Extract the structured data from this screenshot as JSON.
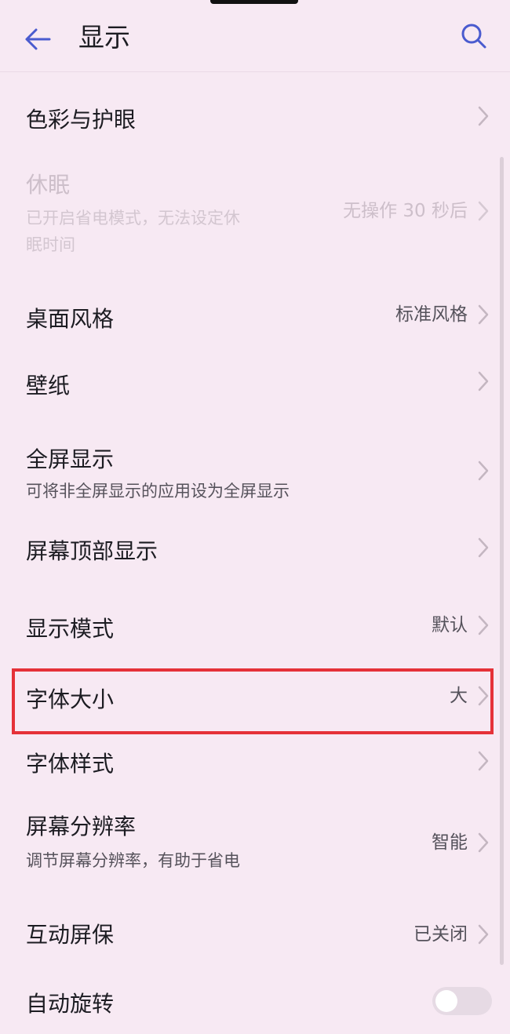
{
  "header": {
    "title": "显示"
  },
  "items": [
    {
      "label": "色彩与护眼"
    },
    {
      "label": "休眠",
      "sub_lines": [
        "已开启省电模式，无法设定休",
        "眠时间"
      ],
      "value": "无操作 30 秒后"
    },
    {
      "label": "桌面风格",
      "value": "标准风格"
    },
    {
      "label": "壁纸"
    },
    {
      "label": "全屏显示",
      "sub": "可将非全屏显示的应用设为全屏显示"
    },
    {
      "label": "屏幕顶部显示"
    },
    {
      "label": "显示模式",
      "value": "默认"
    },
    {
      "label": "字体大小",
      "value": "大"
    },
    {
      "label": "字体样式"
    },
    {
      "label": "屏幕分辨率",
      "sub": "调节屏幕分辨率，有助于省电",
      "value": "智能"
    },
    {
      "label": "互动屏保",
      "value": "已关闭"
    },
    {
      "label": "自动旋转",
      "toggle_on": false
    }
  ],
  "colors": {
    "background": "#f7e9f3",
    "accent": "#4a5bcf",
    "highlight_border": "#e53138"
  },
  "icons": {
    "back": "arrow-left-icon",
    "search": "search-icon",
    "chevron": "chevron-right-icon"
  }
}
